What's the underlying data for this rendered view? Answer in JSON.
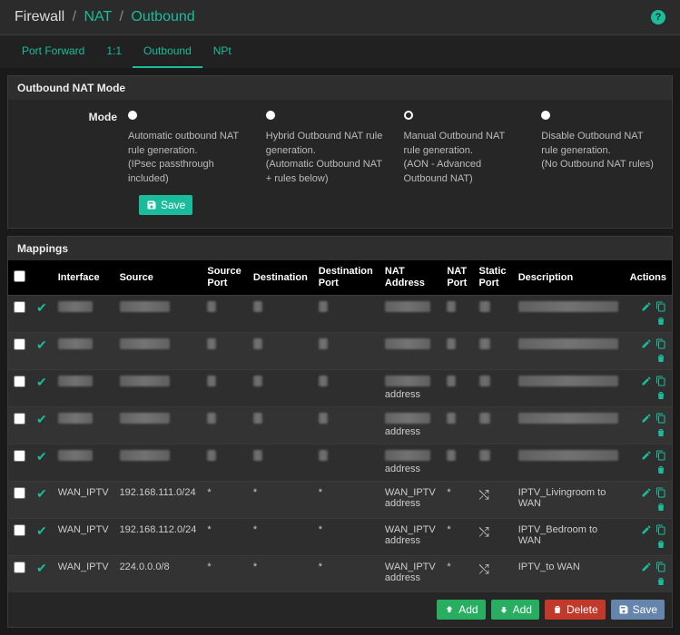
{
  "breadcrumb": {
    "a": "Firewall",
    "b": "NAT",
    "c": "Outbound"
  },
  "tabs": [
    {
      "label": "Port Forward"
    },
    {
      "label": "1:1"
    },
    {
      "label": "Outbound"
    },
    {
      "label": "NPt"
    }
  ],
  "mode_panel": {
    "title": "Outbound NAT Mode",
    "label": "Mode",
    "save": "Save",
    "options": [
      {
        "text": "Automatic outbound NAT rule generation.\n(IPsec passthrough included)"
      },
      {
        "text": "Hybrid Outbound NAT rule generation.\n(Automatic Outbound NAT + rules below)"
      },
      {
        "text": "Manual Outbound NAT rule generation.\n(AON - Advanced Outbound NAT)"
      },
      {
        "text": "Disable Outbound NAT rule generation.\n(No Outbound NAT rules)"
      }
    ]
  },
  "mappings": {
    "title": "Mappings",
    "headers": {
      "interface": "Interface",
      "source": "Source",
      "src_port": "Source Port",
      "destination": "Destination",
      "dst_port": "Destination Port",
      "nat_addr": "NAT Address",
      "nat_port": "NAT Port",
      "static_port": "Static Port",
      "description": "Description",
      "actions": "Actions"
    },
    "rows": [
      {
        "redacted": true,
        "note": "",
        "addr_suffix": ""
      },
      {
        "redacted": true,
        "note": "",
        "addr_suffix": ""
      },
      {
        "redacted": true,
        "note": "",
        "addr_suffix": "address"
      },
      {
        "redacted": true,
        "note": "",
        "addr_suffix": "address"
      },
      {
        "redacted": true,
        "note": "",
        "addr_suffix": "address"
      },
      {
        "redacted": false,
        "interface": "WAN_IPTV",
        "source": "192.168.111.0/24",
        "src_port": "*",
        "destination": "*",
        "dst_port": "*",
        "nat_addr": "WAN_IPTV address",
        "nat_port": "*",
        "static_port": "shuffle",
        "description": "IPTV_Livingroom to WAN"
      },
      {
        "redacted": false,
        "interface": "WAN_IPTV",
        "source": "192.168.112.0/24",
        "src_port": "*",
        "destination": "*",
        "dst_port": "*",
        "nat_addr": "WAN_IPTV address",
        "nat_port": "*",
        "static_port": "shuffle",
        "description": "IPTV_Bedroom to WAN"
      },
      {
        "redacted": false,
        "interface": "WAN_IPTV",
        "source": "224.0.0.0/8",
        "src_port": "*",
        "destination": "*",
        "dst_port": "*",
        "nat_addr": "WAN_IPTV address",
        "nat_port": "*",
        "static_port": "shuffle",
        "description": "IPTV_to WAN"
      }
    ]
  },
  "footer": {
    "add": "Add",
    "delete": "Delete",
    "save": "Save"
  }
}
